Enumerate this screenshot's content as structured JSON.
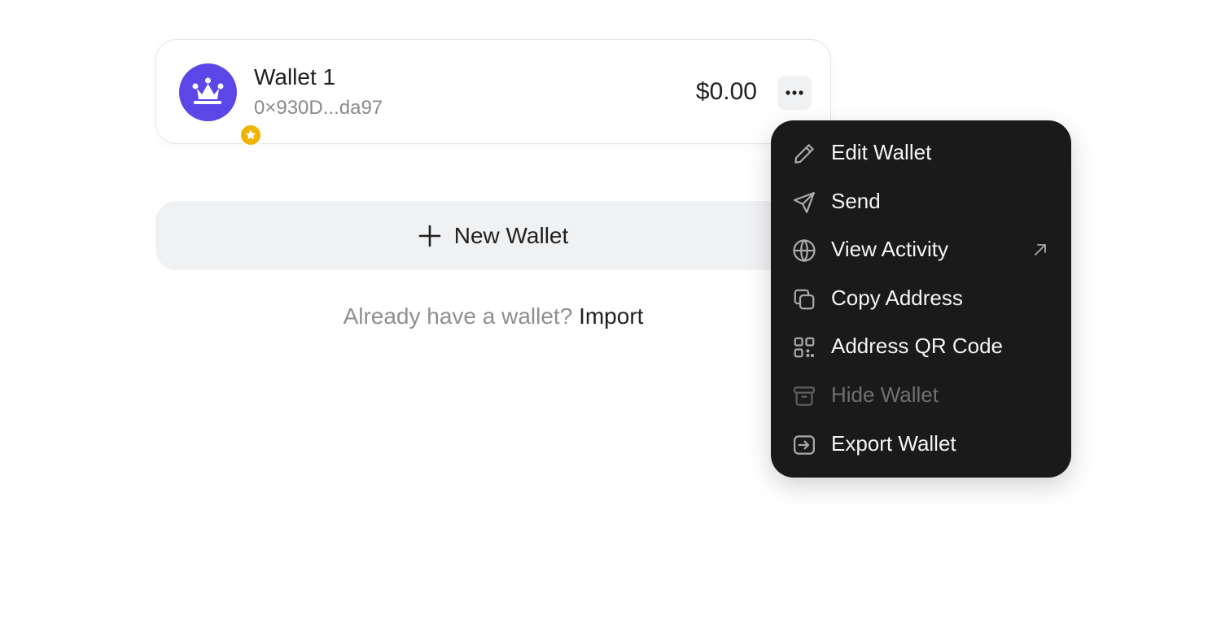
{
  "wallet": {
    "name": "Wallet 1",
    "address": "0×930D...da97",
    "balance": "$0.00",
    "avatar_icon": "crown-icon",
    "badge_icon": "star-icon",
    "avatar_color": "#5b47e8",
    "badge_color": "#f0b400"
  },
  "new_wallet": {
    "label": "New Wallet",
    "icon": "plus-icon"
  },
  "import": {
    "question": "Already have a wallet?",
    "link": "Import"
  },
  "menu": {
    "items": [
      {
        "label": "Edit Wallet",
        "icon": "pencil-icon",
        "disabled": false
      },
      {
        "label": "Send",
        "icon": "send-icon",
        "disabled": false
      },
      {
        "label": "View Activity",
        "icon": "globe-icon",
        "disabled": false,
        "external": true
      },
      {
        "label": "Copy Address",
        "icon": "copy-icon",
        "disabled": false
      },
      {
        "label": "Address QR Code",
        "icon": "qr-code-icon",
        "disabled": false
      },
      {
        "label": "Hide Wallet",
        "icon": "archive-icon",
        "disabled": true
      },
      {
        "label": "Export Wallet",
        "icon": "export-icon",
        "disabled": false
      }
    ]
  }
}
